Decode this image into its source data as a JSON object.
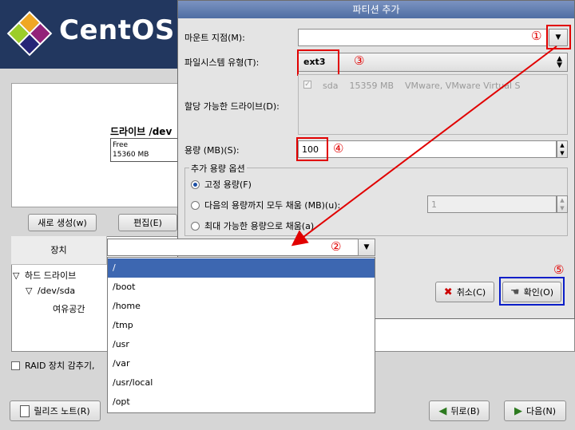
{
  "header": {
    "logo_text": "CentOS"
  },
  "background": {
    "drive_label": "드라이브 /dev",
    "free_label": "Free",
    "free_size": "15360 MB",
    "new_button": "새로 생성(w)",
    "edit_button": "편집(E)",
    "device_header": "장치",
    "tree": {
      "hard_drive": "하드 드라이브",
      "dev_sda": "/dev/sda",
      "free_space": "여유공간"
    },
    "raid_checkbox": "RAID 장치 감추기,",
    "release_notes_button": "릴리즈 노트(R)",
    "back_button": "뒤로(B)",
    "next_button": "다음(N)"
  },
  "dialog": {
    "title": "파티션 추가",
    "mount_label": "마운트 지점(M):",
    "mount_value": "",
    "fs_label": "파일시스템 유형(T):",
    "fs_value": "ext3",
    "drives_label": "할당 가능한 드라이브(D):",
    "drive_row": {
      "name": "sda",
      "size": "15359 MB",
      "model": "VMware, VMware Virtual S"
    },
    "size_label": "용량 (MB)(S):",
    "size_value": "100",
    "options_title": "추가 용량 옵션",
    "option_fixed": "고정 용량(F)",
    "option_fill_upto": "다음의 용량까지 모두 채움 (MB)(u):",
    "fill_upto_value": "1",
    "option_fill_max": "최대 가능한 용량으로 채움(a)",
    "cancel_button": "취소(C)",
    "ok_button": "확인(O)"
  },
  "mount_dropdown": {
    "options": [
      "/",
      "/boot",
      "/home",
      "/tmp",
      "/usr",
      "/var",
      "/usr/local",
      "/opt"
    ],
    "selected_index": 0
  },
  "annotations": {
    "n1": "①",
    "n2": "②",
    "n3": "③",
    "n4": "④",
    "n5": "⑤"
  }
}
